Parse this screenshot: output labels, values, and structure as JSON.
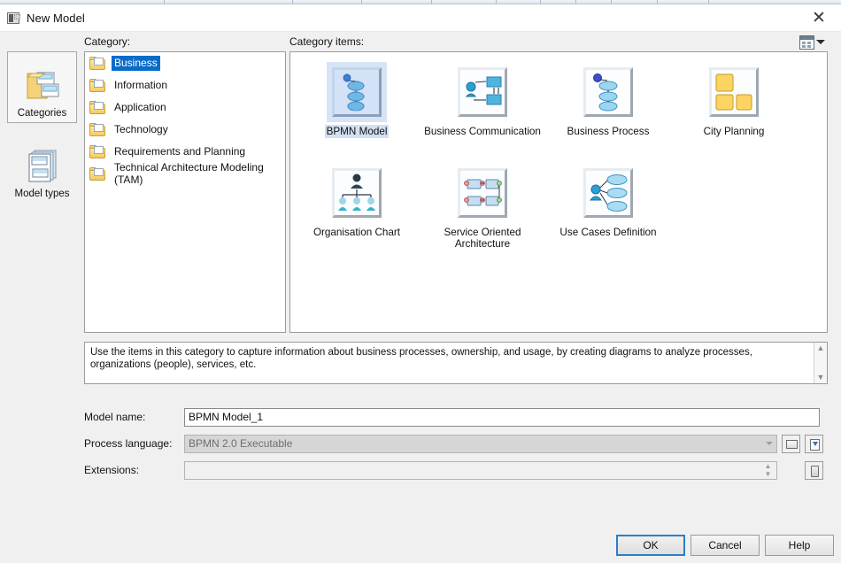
{
  "window": {
    "title": "New Model",
    "title_icon": "model-window-icon",
    "close_icon": "close-icon"
  },
  "sidebar": {
    "items": [
      {
        "label": "Categories",
        "icon": "categories-icon",
        "selected": true
      },
      {
        "label": "Model types",
        "icon": "model-types-icon",
        "selected": false
      }
    ]
  },
  "category": {
    "caption": "Category:",
    "items": [
      {
        "label": "Business",
        "icon": "folder-icon",
        "selected": true
      },
      {
        "label": "Information",
        "icon": "folder-icon",
        "selected": false
      },
      {
        "label": "Application",
        "icon": "folder-icon",
        "selected": false
      },
      {
        "label": "Technology",
        "icon": "folder-icon",
        "selected": false
      },
      {
        "label": "Requirements and Planning",
        "icon": "folder-icon",
        "selected": false
      },
      {
        "label": "Technical Architecture Modeling (TAM)",
        "icon": "folder-icon",
        "selected": false
      }
    ]
  },
  "category_items": {
    "caption": "Category items:",
    "view_button": {
      "icon": "view-mode-icon",
      "dropdown_icon": "chevron-down-icon"
    },
    "items": [
      {
        "label": "BPMN Model",
        "icon": "bpmn-model-icon",
        "selected": true
      },
      {
        "label": "Business Communication",
        "icon": "business-communication-icon",
        "selected": false
      },
      {
        "label": "Business Process",
        "icon": "business-process-icon",
        "selected": false
      },
      {
        "label": "City Planning",
        "icon": "city-planning-icon",
        "selected": false
      },
      {
        "label": "Organisation Chart",
        "icon": "organisation-chart-icon",
        "selected": false
      },
      {
        "label": "Service Oriented Architecture",
        "icon": "service-oriented-architecture-icon",
        "selected": false
      },
      {
        "label": "Use Cases Definition",
        "icon": "use-cases-definition-icon",
        "selected": false
      }
    ]
  },
  "description": {
    "text": "Use the items in this category to capture information about business processes, ownership, and usage, by creating diagrams to analyze processes, organizations (people), services, etc.",
    "scroll_up_icon": "scroll-up-icon",
    "scroll_down_icon": "scroll-down-icon"
  },
  "form": {
    "model_name": {
      "label": "Model name:",
      "value": "BPMN Model_1",
      "placeholder": ""
    },
    "process_language": {
      "label": "Process language:",
      "value": "BPMN 2.0 Executable",
      "disabled": true,
      "dropdown_icon": "chevron-down-icon",
      "buttons": [
        {
          "icon": "open-folder-icon"
        },
        {
          "icon": "import-icon"
        }
      ]
    },
    "extensions": {
      "label": "Extensions:",
      "value": "",
      "placeholder": "",
      "spinner_icon": "spinner-icon",
      "buttons": [
        {
          "icon": "browse-icon"
        }
      ]
    }
  },
  "buttons": {
    "ok": "OK",
    "cancel": "Cancel",
    "help": "Help"
  },
  "colors": {
    "selection_blue": "#0a6cc9",
    "default_button_border": "#2a7fc9",
    "dialog_background": "#f0f0f0",
    "panel_background": "#ffffff"
  }
}
